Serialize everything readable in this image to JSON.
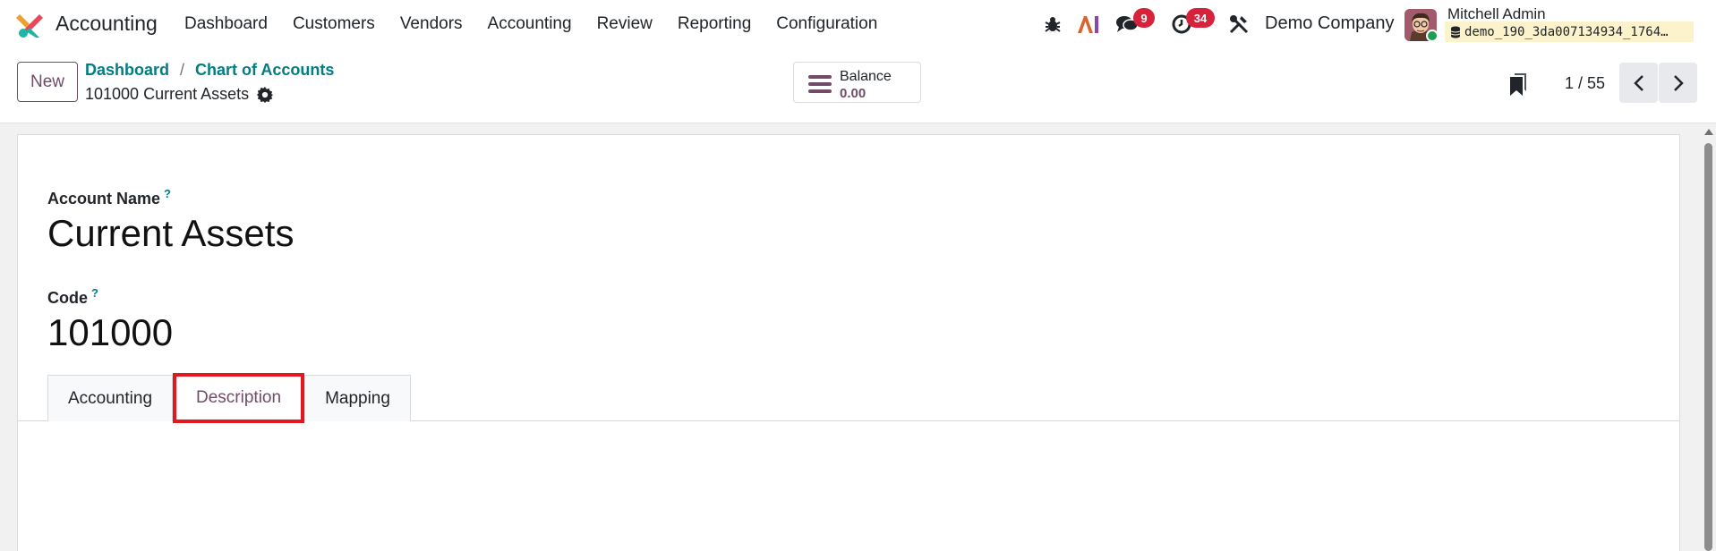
{
  "navbar": {
    "app_name": "Accounting",
    "menu": [
      "Dashboard",
      "Customers",
      "Vendors",
      "Accounting",
      "Review",
      "Reporting",
      "Configuration"
    ],
    "messages_badge": "9",
    "activities_badge": "34",
    "company": "Demo Company",
    "user_name": "Mitchell Admin",
    "database": "demo_190_3da007134934_1764…"
  },
  "control_panel": {
    "new_label": "New",
    "breadcrumb": [
      "Dashboard",
      "Chart of Accounts"
    ],
    "breadcrumb_separator": "/",
    "record_title": "101000 Current Assets",
    "balance_label": "Balance",
    "balance_value": "0.00",
    "pager": "1 / 55"
  },
  "form": {
    "account_name_label": "Account Name",
    "account_name": "Current Assets",
    "code_label": "Code",
    "code": "101000",
    "help_mark": "?",
    "tabs": [
      "Accounting",
      "Description",
      "Mapping"
    ],
    "active_tab": "Description"
  },
  "colors": {
    "brand": "#714b67",
    "link": "#017e84",
    "badge": "#d8213a",
    "highlight": "#e2181f"
  }
}
